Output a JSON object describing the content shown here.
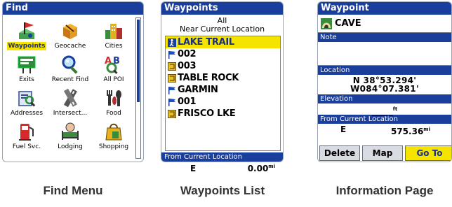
{
  "find_menu": {
    "title": "Find",
    "items": [
      {
        "label": "Waypoints",
        "icon": "waypoints-flag-icon",
        "selected": true
      },
      {
        "label": "Geocache",
        "icon": "geocache-box-icon",
        "selected": false
      },
      {
        "label": "Cities",
        "icon": "city-buildings-icon",
        "selected": false
      },
      {
        "label": "Exits",
        "icon": "exit-sign-icon",
        "selected": false
      },
      {
        "label": "Recent Find",
        "icon": "magnifier-icon",
        "selected": false
      },
      {
        "label": "All POI",
        "icon": "all-poi-icon",
        "selected": false
      },
      {
        "label": "Addresses",
        "icon": "address-book-icon",
        "selected": false
      },
      {
        "label": "Intersect...",
        "icon": "intersection-icon",
        "selected": false
      },
      {
        "label": "Food",
        "icon": "food-utensils-icon",
        "selected": false
      },
      {
        "label": "Fuel Svc.",
        "icon": "fuel-pump-icon",
        "selected": false
      },
      {
        "label": "Lodging",
        "icon": "lodging-bed-icon",
        "selected": false
      },
      {
        "label": "Shopping",
        "icon": "shopping-bag-icon",
        "selected": false
      }
    ],
    "caption": "Find Menu"
  },
  "waypoints_list": {
    "title": "Waypoints",
    "filter_line1": "All",
    "filter_line2": "Near Current Location",
    "items": [
      {
        "name": "LAKE TRAIL",
        "icon": "trail-symbol-icon",
        "selected": true
      },
      {
        "name": "002",
        "icon": "blue-flag-icon",
        "selected": false
      },
      {
        "name": "003",
        "icon": "yellow-cache-icon",
        "selected": false
      },
      {
        "name": "TABLE ROCK",
        "icon": "yellow-cache-icon",
        "selected": false
      },
      {
        "name": "GARMIN",
        "icon": "blue-flag-icon",
        "selected": false
      },
      {
        "name": "001",
        "icon": "blue-flag-icon",
        "selected": false
      },
      {
        "name": "FRISCO LKE",
        "icon": "yellow-cache-icon",
        "selected": false
      }
    ],
    "from_label": "From Current Location",
    "direction": "E",
    "distance": "0.00",
    "distance_unit": "mi",
    "caption": "Waypoints List"
  },
  "info_page": {
    "title": "Waypoint",
    "name": "CAVE",
    "note_label": "Note",
    "location_label": "Location",
    "latitude": "N  38°53.294'",
    "longitude": "W084°07.381'",
    "elevation_label": "Elevation",
    "elevation_value": "_____",
    "elevation_unit": "ft",
    "from_label": "From Current Location",
    "direction": "E",
    "distance": "575.36",
    "distance_unit": "mi",
    "buttons": {
      "delete": "Delete",
      "map": "Map",
      "goto": "Go To"
    },
    "caption": "Information Page"
  },
  "colors": {
    "title_bar": "#1a3e9b",
    "highlight": "#f5e400",
    "flag_blue": "#1f4fc4",
    "cache_yellow": "#e6c020"
  }
}
